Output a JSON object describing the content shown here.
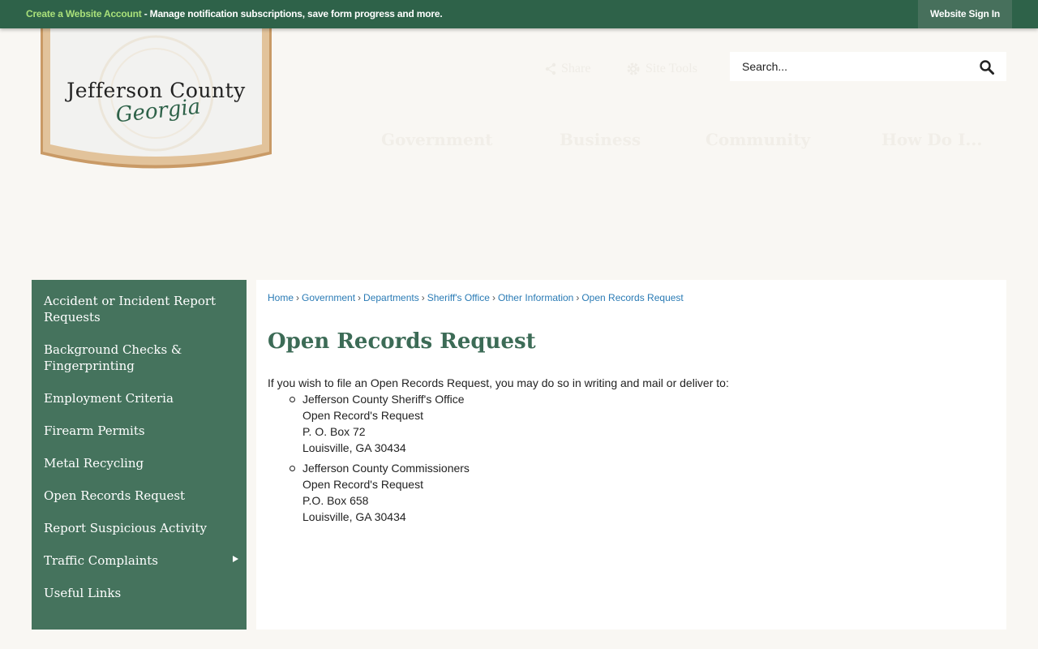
{
  "topbar": {
    "create_account_link": "Create a Website Account",
    "create_account_rest": " - Manage notification subscriptions, save form progress and more.",
    "sign_in": "Website Sign In"
  },
  "logo": {
    "title": "Jefferson County",
    "subtitle": "Georgia"
  },
  "header": {
    "share": "Share",
    "site_tools": "Site Tools",
    "search_placeholder": "Search..."
  },
  "main_nav": [
    "Government",
    "Business",
    "Community",
    "How Do I..."
  ],
  "sidebar": {
    "items": [
      {
        "label": "Accident or Incident Report Requests"
      },
      {
        "label": "Background Checks & Fingerprinting"
      },
      {
        "label": "Employment Criteria"
      },
      {
        "label": "Firearm Permits"
      },
      {
        "label": "Metal Recycling"
      },
      {
        "label": "Open Records Request"
      },
      {
        "label": "Report Suspicious Activity"
      },
      {
        "label": "Traffic Complaints"
      },
      {
        "label": "Useful Links"
      }
    ]
  },
  "breadcrumb": [
    "Home",
    "Government",
    "Departments",
    "Sheriff's Office",
    "Other Information",
    "Open Records Request"
  ],
  "page": {
    "title": "Open Records Request",
    "intro": "If you wish to file an Open Records Request, you may do so in writing and mail or deliver to:",
    "addresses": [
      [
        "Jefferson County Sheriff's Office",
        "Open Record's Request",
        "P. O. Box 72",
        "Louisville, GA 30434"
      ],
      [
        "Jefferson County Commissioners",
        "Open Record's Request",
        "P.O. Box 658",
        "Louisville, GA 30434"
      ]
    ]
  },
  "colors": {
    "topbar": "#2e6249",
    "sidebar": "#45735d",
    "title": "#3c6b56",
    "link": "#2a7bb5"
  }
}
